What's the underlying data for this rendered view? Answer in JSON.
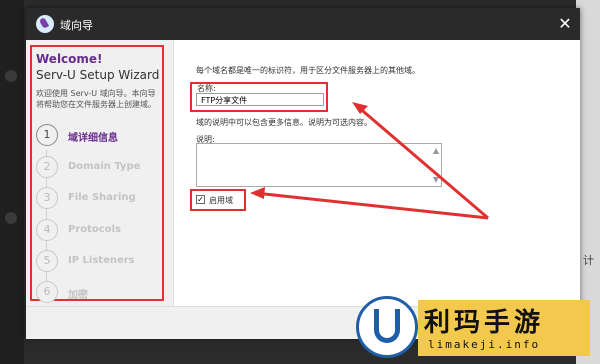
{
  "window": {
    "title": "域向导",
    "close_label": "✕"
  },
  "sidebar": {
    "welcome": "Welcome!",
    "title": "Serv-U Setup Wizard",
    "intro": "欢迎使用 Serv-U 域向导。本向导将帮助您在文件服务器上创建域。",
    "steps": [
      {
        "num": "1",
        "label": "域详细信息"
      },
      {
        "num": "2",
        "label": "Domain Type"
      },
      {
        "num": "3",
        "label": "File Sharing"
      },
      {
        "num": "4",
        "label": "Protocols"
      },
      {
        "num": "5",
        "label": "IP Listeners"
      },
      {
        "num": "6",
        "label": "加密"
      }
    ]
  },
  "content": {
    "description": "每个域名都是唯一的标识符，用于区分文件服务器上的其他域。",
    "name_label": "名称:",
    "name_value": "FTP分享文件",
    "description2": "域的说明中可以包含更多信息。说明为可选内容。",
    "desc_label": "说明:",
    "enable_label": "启用域",
    "enable_checked": "✓"
  },
  "background": {
    "right_text": "计"
  },
  "watermark": {
    "main": "利玛手游",
    "sub": "limakeji.info"
  },
  "colors": {
    "accent": "#6a2c8e",
    "highlight": "#e03030",
    "titlebar": "#2a2a2a"
  }
}
